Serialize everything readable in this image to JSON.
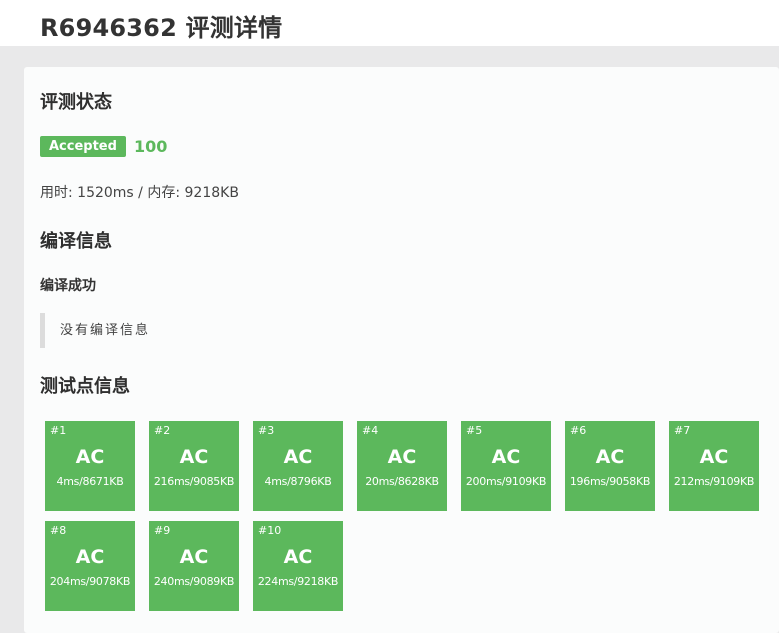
{
  "header": {
    "title": "R6946362 评测详情"
  },
  "status_section": {
    "title": "评测状态",
    "badge": "Accepted",
    "score": "100",
    "stats": "用时: 1520ms / 内存: 9218KB",
    "badge_color": "#5cb85c"
  },
  "compile_section": {
    "title": "编译信息",
    "status": "编译成功",
    "message": "没有编译信息"
  },
  "tests_section": {
    "title": "测试点信息",
    "cases": [
      {
        "id": "#1",
        "result": "AC",
        "detail": "4ms/8671KB"
      },
      {
        "id": "#2",
        "result": "AC",
        "detail": "216ms/9085KB"
      },
      {
        "id": "#3",
        "result": "AC",
        "detail": "4ms/8796KB"
      },
      {
        "id": "#4",
        "result": "AC",
        "detail": "20ms/8628KB"
      },
      {
        "id": "#5",
        "result": "AC",
        "detail": "200ms/9109KB"
      },
      {
        "id": "#6",
        "result": "AC",
        "detail": "196ms/9058KB"
      },
      {
        "id": "#7",
        "result": "AC",
        "detail": "212ms/9109KB"
      },
      {
        "id": "#8",
        "result": "AC",
        "detail": "204ms/9078KB"
      },
      {
        "id": "#9",
        "result": "AC",
        "detail": "240ms/9089KB"
      },
      {
        "id": "#10",
        "result": "AC",
        "detail": "224ms/9218KB"
      }
    ]
  }
}
